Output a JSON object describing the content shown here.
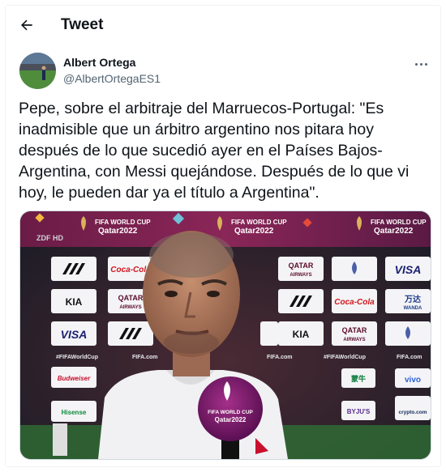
{
  "header": {
    "title": "Tweet",
    "back_icon": "arrow-left-icon"
  },
  "author": {
    "name": "Albert Ortega",
    "handle": "@AlbertOrtegaES1"
  },
  "tweet": {
    "text": "Pepe, sobre el arbitraje del Marruecos-Portugal: \"Es inadmisible que un árbitro argentino nos pitara hoy después de lo que sucedió ayer en el Países Bajos-Argentina, con Messi quejándose. Después de lo que vi hoy, le pueden dar ya el título a Argentina\"."
  },
  "media": {
    "banner_line1": "FIFA WORLD CUP",
    "banner_line2": "Qatar2022",
    "broadcaster": "ZDF HD",
    "sponsors": {
      "coca_cola": "Coca-Cola",
      "qatar": "QATAR",
      "airways": "AIRWAYS",
      "visa": "VISA",
      "wanda": "万达",
      "wanda_en": "WANDA",
      "kia": "KIA",
      "hashtag": "#FIFAWorldCup",
      "fifacom": "FIFA.com",
      "budweiser": "Budweiser",
      "vivo": "vivo",
      "byjus": "BYJU'S",
      "hisense": "Hisense",
      "mengniu": "蒙牛",
      "cryptocom": "crypto.com"
    },
    "mic_line1": "FIFA WORLD CUP",
    "mic_line2": "Qatar2022"
  },
  "colors": {
    "handle": "#536471",
    "banner": "#7a1f4b",
    "board_bg": "#f4f4f6"
  }
}
